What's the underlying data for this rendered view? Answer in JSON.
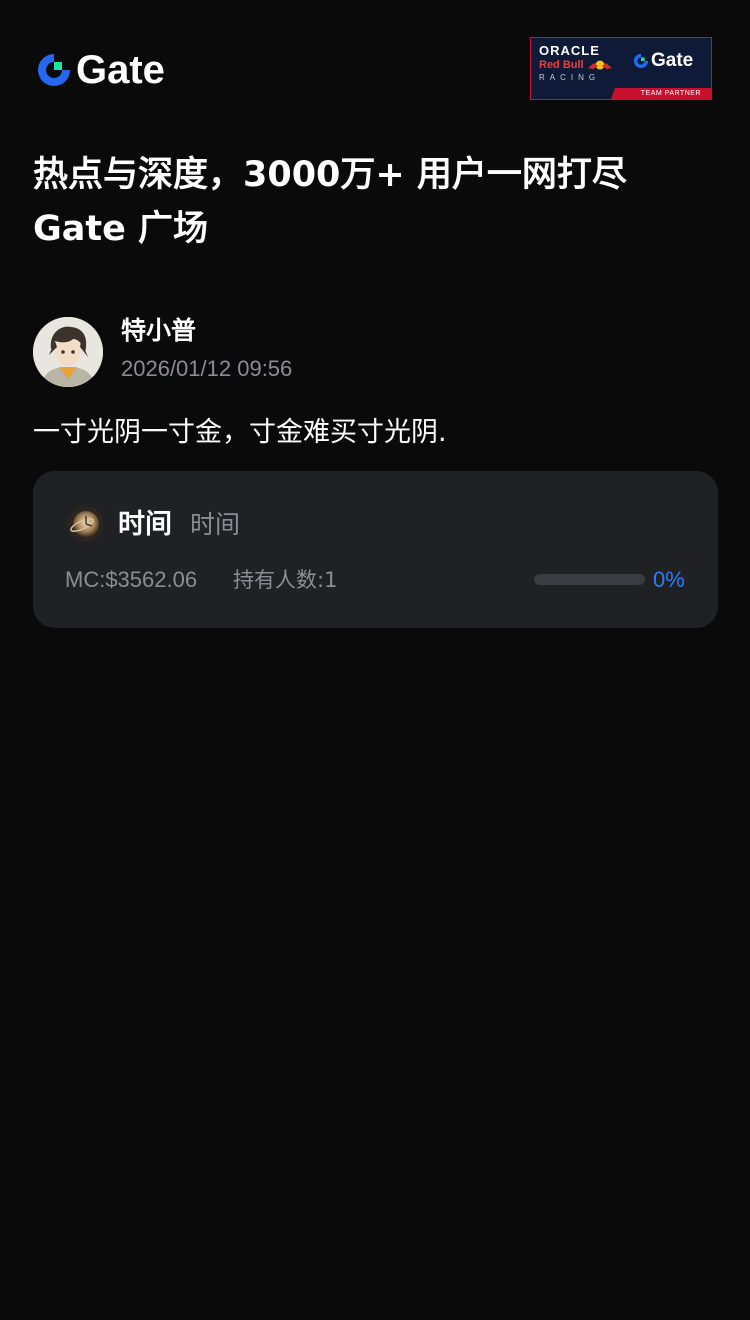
{
  "header": {
    "logo_text": "Gate",
    "logo_icon": "gate-logo-icon",
    "partner_badge": {
      "oracle": "ORACLE",
      "redbull": "Red Bull",
      "racing": "RACING",
      "gate": "Gate",
      "tag": "TEAM PARTNER"
    }
  },
  "headline": "热点与深度，3000万+ 用户一网打尽 Gate 广场",
  "post": {
    "author_name": "特小普",
    "timestamp": "2026/01/12 09:56",
    "text": "一寸光阴一寸金，寸金难买寸光阴."
  },
  "token_card": {
    "icon": "token-clock-icon",
    "name": "时间",
    "symbol": "时间",
    "market_cap": "MC:$3562.06",
    "holders": "持有人数:1",
    "progress_percent": 0,
    "progress_label": "0%"
  },
  "colors": {
    "background": "#0a0a0b",
    "card": "#1f2125",
    "accent": "#2f7cf6",
    "muted_text": "#8a8d93"
  }
}
